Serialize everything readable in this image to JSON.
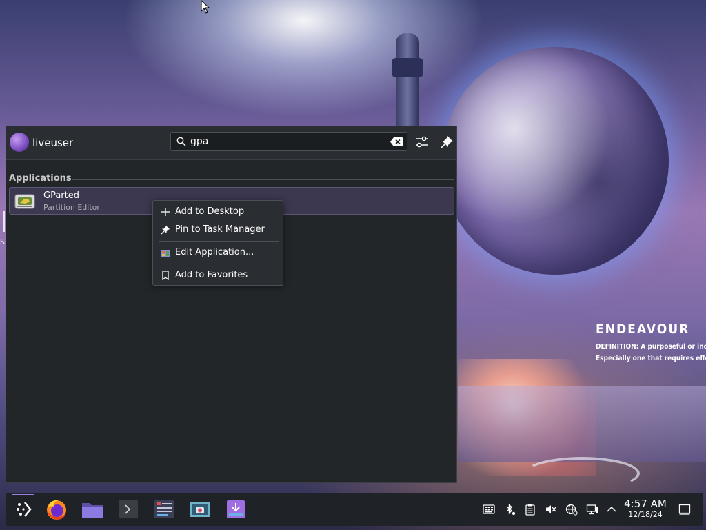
{
  "wallpaper": {
    "title": "ENDEAVOUR",
    "definition_line1": "DEFINITION: A purposeful or indust",
    "definition_line2": "Especially one that requires effort c",
    "edge_text": "S,"
  },
  "launcher": {
    "username": "liveuser",
    "search": {
      "value": "gpa",
      "placeholder": ""
    },
    "section_title": "Applications",
    "results": [
      {
        "name": "GParted",
        "description": "Partition Editor",
        "icon": "gparted-icon"
      }
    ]
  },
  "context_menu": {
    "items": [
      {
        "label": "Add to Desktop",
        "icon": "plus-icon"
      },
      {
        "label": "Pin to Task Manager",
        "icon": "pin-icon"
      },
      {
        "label": "Edit Application...",
        "icon": "edit-application-icon"
      },
      {
        "label": "Add to Favorites",
        "icon": "bookmark-icon"
      }
    ]
  },
  "taskbar": {
    "apps": [
      {
        "name": "application-launcher",
        "active": true
      },
      {
        "name": "firefox",
        "active": false
      },
      {
        "name": "file-manager",
        "active": false
      },
      {
        "name": "terminal",
        "active": false
      },
      {
        "name": "system-monitor",
        "active": false
      },
      {
        "name": "screenshot-tool",
        "active": false
      },
      {
        "name": "installer",
        "active": false
      }
    ],
    "tray": [
      "keyboard-icon",
      "bluetooth-icon",
      "clipboard-icon",
      "volume-muted-icon",
      "network-globe-icon",
      "display-icon",
      "chevron-up-icon"
    ],
    "clock": {
      "time": "4:57 AM",
      "date": "12/18/24"
    }
  },
  "colors": {
    "panel_bg": "#232629",
    "accent": "#9f7ee6",
    "selection_bg": "#3b3850",
    "text": "#fcfcfc"
  }
}
